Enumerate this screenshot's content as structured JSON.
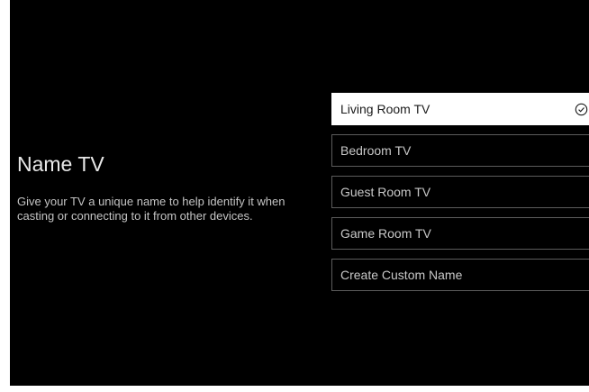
{
  "page": {
    "title": "Name TV",
    "description": "Give your TV a unique name to help identify it when casting or connecting to it from other devices."
  },
  "options": [
    {
      "label": "Living Room TV",
      "selected": true,
      "icon": "check-circle-icon"
    },
    {
      "label": "Bedroom TV",
      "selected": false
    },
    {
      "label": "Guest Room TV",
      "selected": false
    },
    {
      "label": "Game Room TV",
      "selected": false
    },
    {
      "label": "Create Custom Name",
      "selected": false
    }
  ],
  "colors": {
    "background": "#000000",
    "selected_background": "#ffffff",
    "text": "#e8e8e8",
    "border": "#5c5c5c"
  }
}
